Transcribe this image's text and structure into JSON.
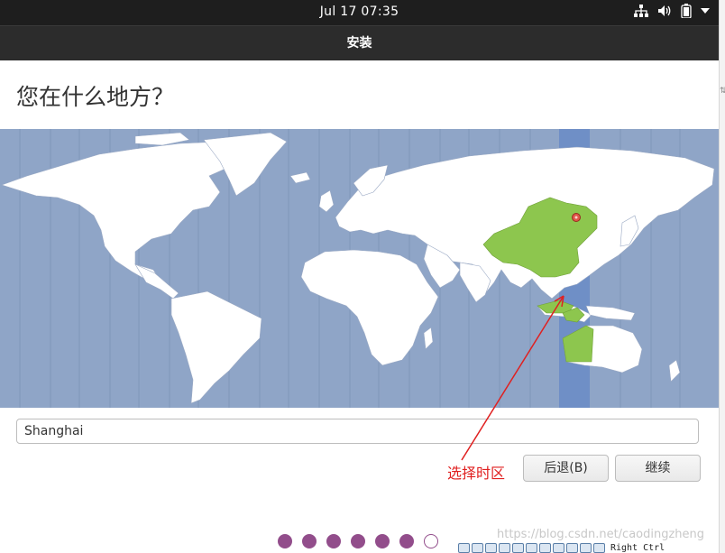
{
  "topbar": {
    "clock": "Jul 17  07:35",
    "icons": [
      "network-icon",
      "volume-icon",
      "battery-icon",
      "system-menu-chevron-icon"
    ]
  },
  "window": {
    "title": "安装"
  },
  "page": {
    "heading": "您在什么地方？"
  },
  "map": {
    "background_color": "#8fa5c7",
    "land_color": "#ffffff",
    "selected_zone_color": "#6f8fc6",
    "selected_country_color": "#8dc64e",
    "pin_color": "#e0584a"
  },
  "timezone_input": {
    "value": "Shanghai"
  },
  "annotation": {
    "text": "选择时区",
    "color": "#e02020"
  },
  "buttons": {
    "back_label": "后退(B)",
    "continue_label": "继续"
  },
  "progress": {
    "total_steps": 7,
    "completed_steps": 6,
    "dot_color": "#924d8b"
  },
  "watermark": "https://blog.csdn.net/caodingzheng",
  "vbox_statusbar": {
    "host_key": "Right Ctrl"
  }
}
